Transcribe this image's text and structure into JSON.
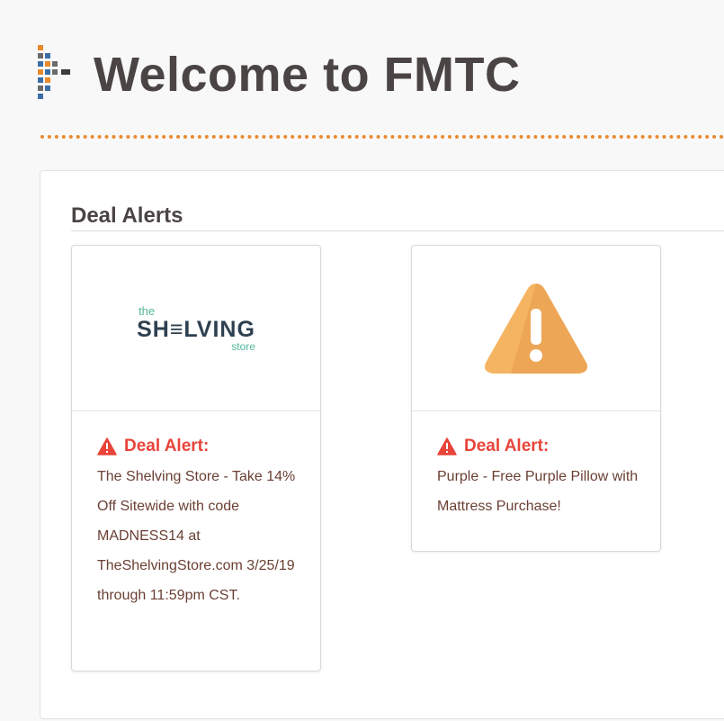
{
  "page": {
    "title": "Welcome to FMTC"
  },
  "colors": {
    "accent": "#e98a2d",
    "alert": "#e8443a",
    "title": "#4a4544"
  },
  "deal_alerts": {
    "title": "Deal Alerts",
    "cards": [
      {
        "image_icon": "shelving-store-logo",
        "logo": {
          "small": "the",
          "main": "SH≡LVING",
          "sub": "store"
        },
        "alert_label": "Deal Alert:",
        "text": "The Shelving Store - Take 14% Off Sitewide with code MADNESS14 at TheShelvingStore.com 3/25/19 through 11:59pm CST."
      },
      {
        "image_icon": "warning-triangle-icon",
        "alert_label": "Deal Alert:",
        "text": "Purple - Free Purple Pillow with Mattress Purchase!"
      }
    ]
  }
}
